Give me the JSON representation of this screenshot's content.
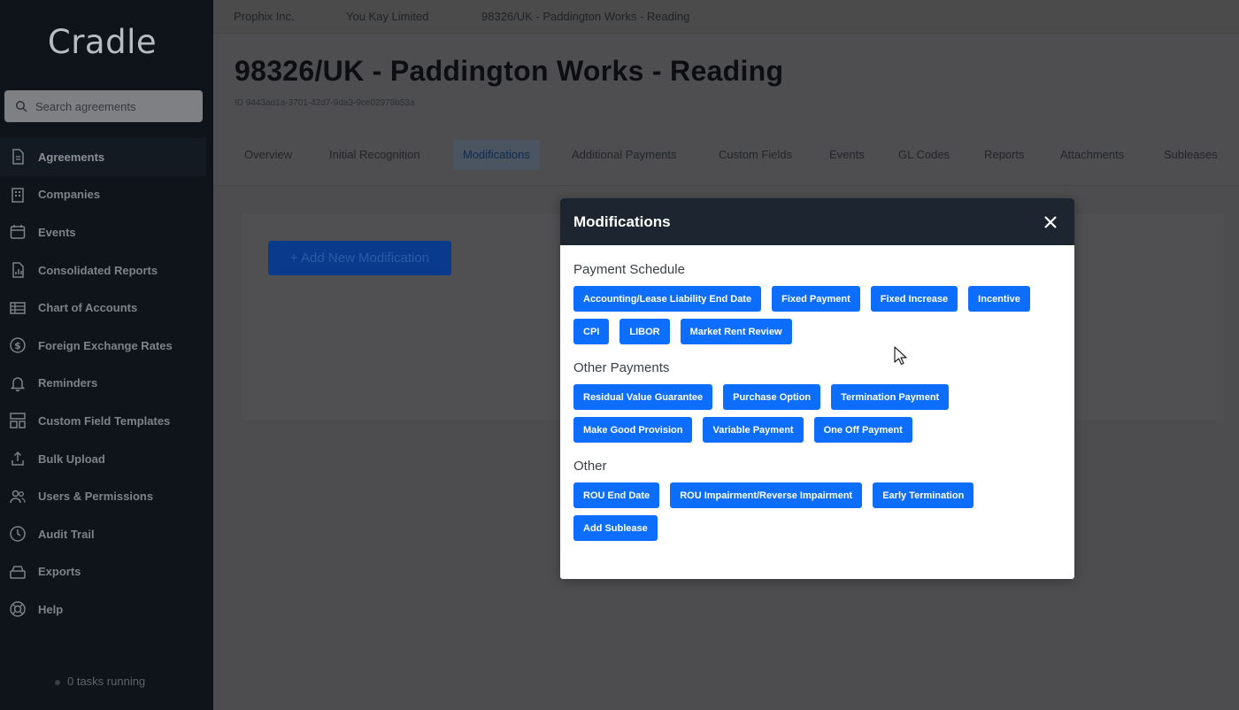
{
  "app": {
    "logo": "Cradle",
    "tasks_status": "0 tasks running"
  },
  "search": {
    "placeholder": "Search agreements"
  },
  "sidebar": {
    "items": [
      {
        "label": "Agreements",
        "icon": "document-icon"
      },
      {
        "label": "Companies",
        "icon": "building-icon"
      },
      {
        "label": "Events",
        "icon": "calendar-icon"
      },
      {
        "label": "Consolidated Reports",
        "icon": "report-icon"
      },
      {
        "label": "Chart of Accounts",
        "icon": "table-icon"
      },
      {
        "label": "Foreign Exchange Rates",
        "icon": "dollar-icon"
      },
      {
        "label": "Reminders",
        "icon": "bell-icon"
      },
      {
        "label": "Custom Field Templates",
        "icon": "template-icon"
      },
      {
        "label": "Bulk Upload",
        "icon": "upload-icon"
      },
      {
        "label": "Users & Permissions",
        "icon": "users-icon"
      },
      {
        "label": "Audit Trail",
        "icon": "clock-icon"
      },
      {
        "label": "Exports",
        "icon": "archive-icon"
      },
      {
        "label": "Help",
        "icon": "lifebuoy-icon"
      }
    ]
  },
  "breadcrumb": [
    "Prophix Inc.",
    "You Kay Limited",
    "98326/UK - Paddington Works - Reading"
  ],
  "page": {
    "title": "98326/UK - Paddington Works - Reading",
    "id_text": "ID 9443ad1a-3701-42d7-9da3-9ce02978b53a"
  },
  "tabs": [
    "Overview",
    "Initial Recognition",
    "Modifications",
    "Additional Payments",
    "Custom Fields",
    "Events",
    "GL Codes",
    "Reports",
    "Attachments",
    "Subleases"
  ],
  "active_tab": "Modifications",
  "main": {
    "add_button": "+ Add New Modification"
  },
  "modal": {
    "title": "Modifications",
    "sections": [
      {
        "title": "Payment Schedule",
        "buttons": [
          "Accounting/Lease Liability End Date",
          "Fixed Payment",
          "Fixed Increase",
          "Incentive",
          "CPI",
          "LIBOR",
          "Market Rent Review"
        ]
      },
      {
        "title": "Other Payments",
        "buttons": [
          "Residual Value Guarantee",
          "Purchase Option",
          "Termination Payment",
          "Make Good Provision",
          "Variable Payment",
          "One Off Payment"
        ]
      },
      {
        "title": "Other",
        "buttons": [
          "ROU End Date",
          "ROU Impairment/Reverse Impairment",
          "Early Termination",
          "Add Sublease"
        ]
      }
    ]
  },
  "colors": {
    "sidebar_bg": "#0f141b",
    "modal_header": "#1d2530",
    "accent": "#0d6efd",
    "overlay": "#4d4d4f"
  }
}
